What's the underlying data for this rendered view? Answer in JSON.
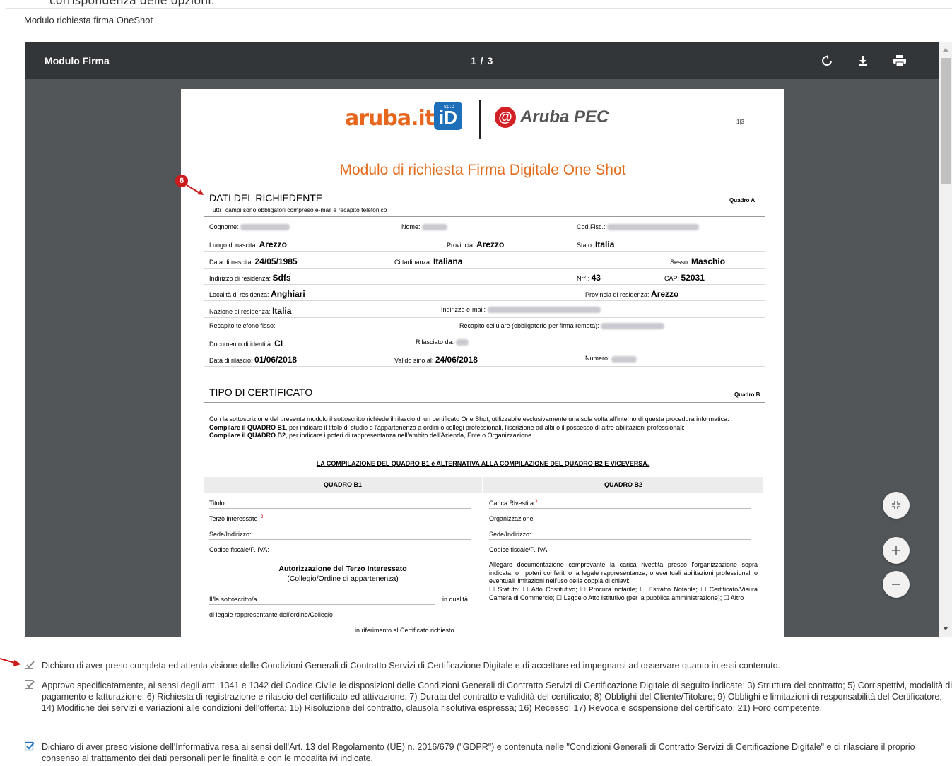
{
  "top_cut_text": "corrispondenza delle opzioni.",
  "form_title": "Modulo richiesta firma OneShot",
  "viewer": {
    "title": "Modulo Firma",
    "pages": "1 / 3",
    "icons": [
      "rotate-icon",
      "download-icon",
      "print-icon"
    ],
    "fabs": [
      "fit-page-icon",
      "zoom-in-icon",
      "zoom-out-icon"
    ]
  },
  "document": {
    "logo_aruba": "aruba.it",
    "logo_id": "iD",
    "logo_spid": "sp:d",
    "logo_pec_symbol": "@",
    "logo_pec": "Aruba PEC",
    "page_num": "1|3",
    "title": "Modulo di richiesta Firma Digitale One Shot",
    "marker": "6",
    "section_a": "DATI DEL RICHIEDENTE",
    "quadro_a": "Quadro A",
    "subtitle": "Tutti i campi sono obbligatori compreso e-mail e recapito telefonico",
    "rows": [
      [
        {
          "label": "Cognome:",
          "value": "",
          "blur": 70
        },
        {
          "label": "Nome:",
          "value": "",
          "blur": 36
        },
        {
          "label": "Cod.Fisc.:",
          "value": "",
          "blur": 130
        }
      ],
      [
        {
          "label": "Luogo di nascita:",
          "value": "Arezzo"
        },
        {
          "label": "Provincia:",
          "value": "Arezzo"
        },
        {
          "label": "Stato:",
          "value": "Italia"
        }
      ],
      [
        {
          "label": "Data di nascita:",
          "value": "24/05/1985"
        },
        {
          "label": "Cittadinanza:",
          "value": "Italiana"
        },
        {
          "label": "Sesso:",
          "value": "Maschio"
        }
      ],
      [
        {
          "label": "Indirizzo di residenza:",
          "value": "Sdfs"
        },
        {
          "label": "Nr°.:",
          "value": "43"
        },
        {
          "label": "CAP:",
          "value": "52031"
        }
      ],
      [
        {
          "label": "Località di residenza:",
          "value": "Anghiari"
        },
        {
          "label": "Provincia di residenza:",
          "value": "Arezzo"
        }
      ],
      [
        {
          "label": "Nazione di residenza:",
          "value": "Italia"
        },
        {
          "label": "Indirizzo e-mail:",
          "value": "",
          "blur": 160
        }
      ],
      [
        {
          "label": "Recapito telefono fisso:",
          "value": ""
        },
        {
          "label": "Recapito cellulare (obbligatorio per firma remota):",
          "value": "",
          "blur": 90
        }
      ],
      [
        {
          "label": "Documento di identità:",
          "value": "CI"
        },
        {
          "label": "Rilasciato da:",
          "value": "",
          "blur": 18
        }
      ],
      [
        {
          "label": "Data di rilascio:",
          "value": "01/06/2018"
        },
        {
          "label": "Valido sino al:",
          "value": "24/06/2018"
        },
        {
          "label": "Numero:",
          "value": "",
          "blur": 36
        }
      ]
    ],
    "section_b": "TIPO DI CERTIFICATO",
    "quadro_b": "Quadro B",
    "para_1": "Con la sottoscrizione del presente modulo il sottoscritto richiede il rilascio di un certificato One Shot, utilizzabile esclusivamente una sola volta all'interno di questa procedura informatica.",
    "para_2_bold": "Compilare il QUADRO B1",
    "para_2": ", per indicare il titolo di studio o l'appartenenza a ordini o collegi professionali, l'iscrizione ad albi o il possesso di altre abilitazioni professionali;",
    "para_3_bold": "Compilare il QUADRO B2",
    "para_3": ", per indicare i poteri di rappresentanza nell'ambito dell'Azienda, Ente o Organizzazione.",
    "alternative": "LA COMPILAZIONE DEL QUADRO B1 è ALTERNATIVA ALLA COMPILAZIONE DEL QUADRO B2 E VICEVERSA.",
    "b1": {
      "head": "QUADRO B1",
      "fields": [
        "Titolo",
        "Terzo interessato",
        "Sede/Indirizzo:",
        "Codice fiscale/P. IVA:"
      ],
      "sup": "2",
      "auth_title": "Autorizzazione del Terzo Interessato",
      "auth_sub": "(Collegio/Ordine di appartenenza)",
      "line1_a": "Il/la sottoscritto/a",
      "line1_b": "in qualità",
      "line2": "di legale rappresentante dell'ordine/Collegio",
      "line3": "in riferimento al Certificato richiesto"
    },
    "b2": {
      "head": "QUADRO B2",
      "fields": [
        "Carica Rivestita",
        "Organizzazione",
        "Sede/Indirizzo:",
        "Codice fiscale/P. IVA:"
      ],
      "sup": "3",
      "text": "Allegare documentazione comprovante la carica rivestita presso l'organizzazione sopra indicata, o i poteri conferiti o la legale rappresentanza, o eventuali abilitazioni professionali o eventuali limitazioni nell'uso della coppia di chiavi:",
      "options": "☐ Statuto; ☐ Atto Costitutivo; ☐ Procura notarile; ☐ Estratto Notarile; ☐ Certificato/Visura Camera di Commercio; ☐ Legge o Atto Istitutivo (per la pubblica amministrazione); ☐ Altro"
    }
  },
  "checkboxes": [
    {
      "text": "Dichiaro di aver preso completa ed attenta visione delle Condizioni Generali di Contratto Servizi di Certificazione Digitale e di accettare ed impegnarsi ad osservare quanto in essi contenuto.",
      "checked": true,
      "active": false
    },
    {
      "text": "Approvo specificatamente, ai sensi degli artt. 1341 e 1342 del Codice Civile le disposizioni delle Condizioni Generali di Contratto Servizi di Certificazione Digitale di seguito indicate: 3) Struttura del contratto; 5) Corrispettivi, modalità di pagamento e fatturazione; 6) Richiesta di registrazione e rilascio del certificato ed attivazione; 7) Durata del contratto e validità del certificato; 8) Obblighi del Cliente/Titolare; 9) Obblighi e limitazioni di responsabilità del Certificatore; 14) Modifiche dei servizi e variazioni alle condizioni dell'offerta; 15) Risoluzione del contratto, clausola risolutiva espressa; 16) Recesso; 17) Revoca e sospensione del certificato; 21) Foro competente.",
      "checked": true,
      "active": false
    },
    {
      "text": "Dichiaro di aver preso visione dell'Informativa resa ai sensi dell'Art. 13 del Regolamento (UE) n. 2016/679 (\"GDPR\") e contenuta nelle \"Condizioni Generali di Contratto Servizi di Certificazione Digitale\" e di rilasciare il proprio consenso al trattamento dei dati personali per le finalità e con le modalità ivi indicate.",
      "checked": true,
      "active": true
    }
  ],
  "colors": {
    "accent": "#1c6fb8",
    "toolbar": "#323639",
    "viewer_bg": "#525659",
    "doc_title": "#e36c1d",
    "marker": "#cc1b1b"
  }
}
